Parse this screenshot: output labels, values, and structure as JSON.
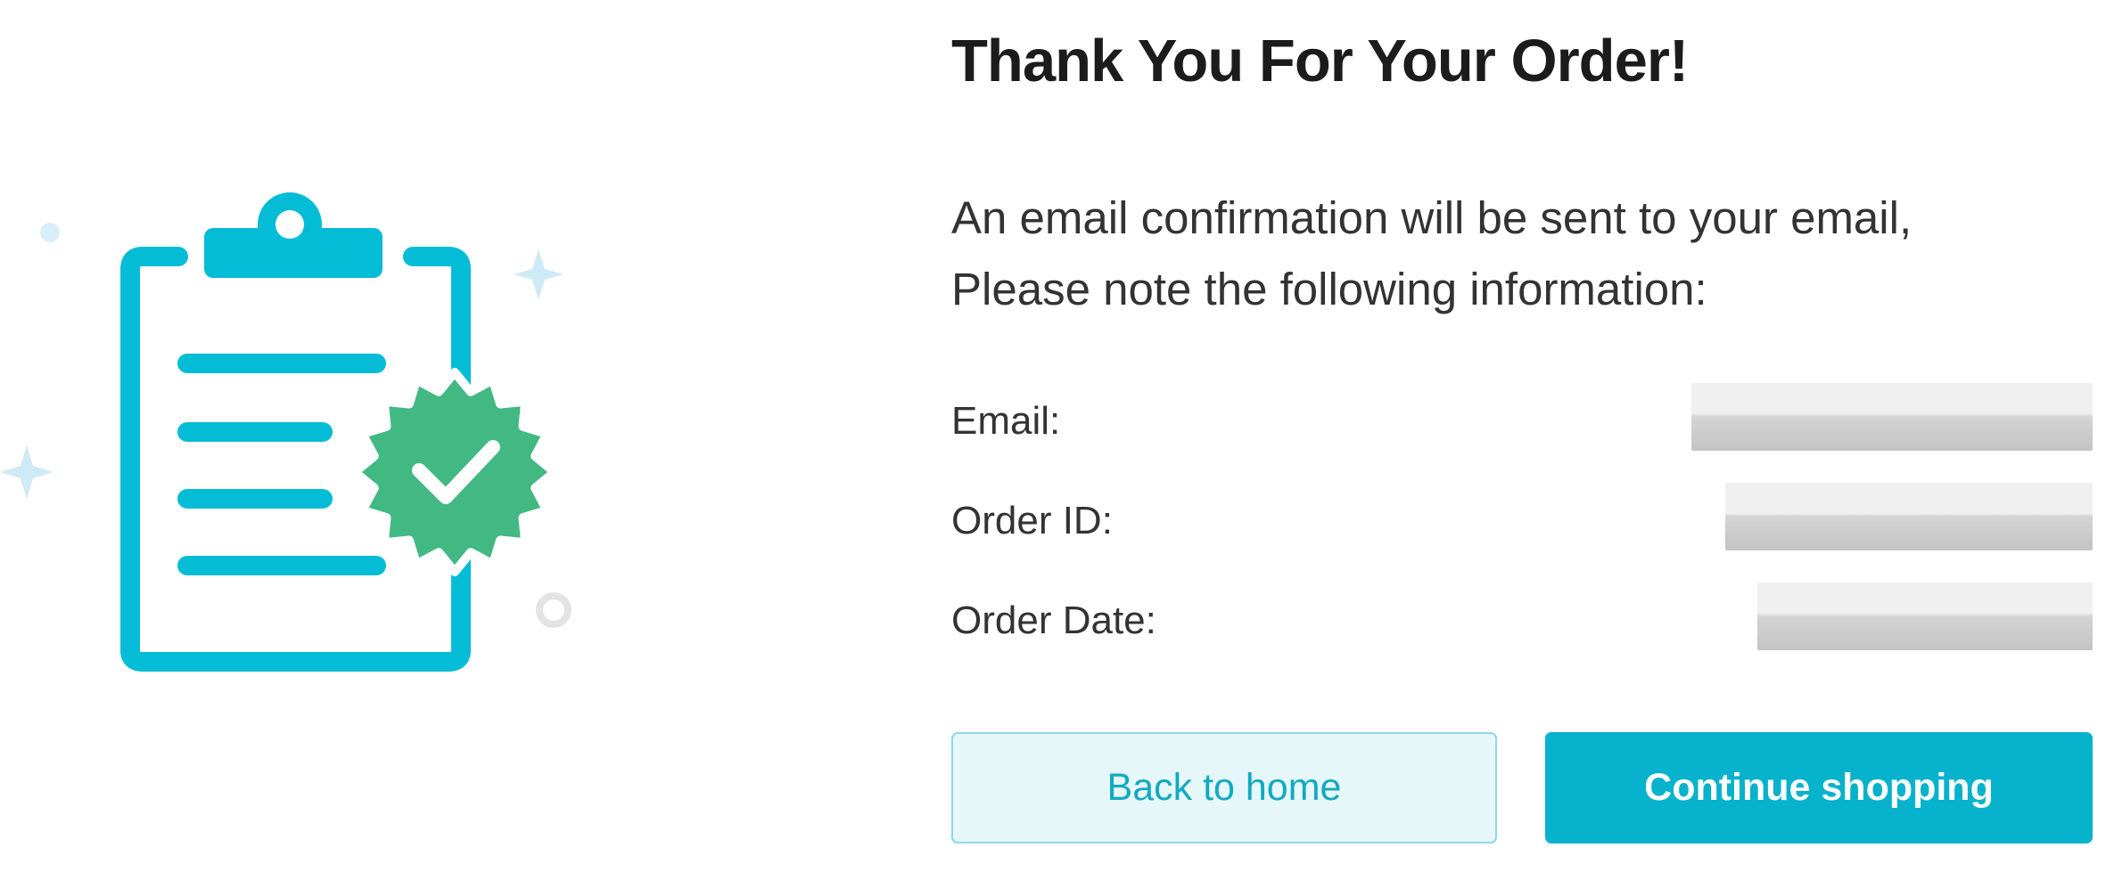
{
  "illustration": {
    "icon": "clipboard-check-icon",
    "accent_color": "#05bcd6",
    "badge_color": "#42b883"
  },
  "heading": {
    "title": "Thank You For Your Order!"
  },
  "message": {
    "line1": "An email confirmation will be sent to your email,",
    "line2": "Please note the following information:"
  },
  "order_info": {
    "rows": [
      {
        "label": "Email:",
        "value_state": "redacted"
      },
      {
        "label": "Order ID:",
        "value_state": "redacted"
      },
      {
        "label": "Order Date:",
        "value_state": "redacted"
      }
    ]
  },
  "actions": {
    "back_label": "Back to home",
    "continue_label": "Continue shopping"
  },
  "colors": {
    "primary": "#06b2cc",
    "primary_light_bg": "#e6f7fa",
    "text": "#333333"
  }
}
